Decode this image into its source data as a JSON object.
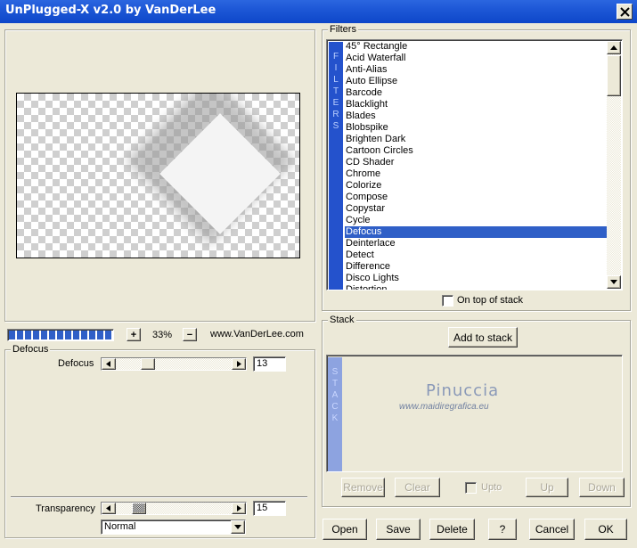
{
  "window": {
    "title": "UnPlugged-X v2.0 by VanDerLee"
  },
  "preview": {
    "zoom": "33%",
    "website": "www.VanDerLee.com",
    "zoom_plus": "+",
    "zoom_minus": "−"
  },
  "defocus": {
    "group_label": "Defocus",
    "param_label": "Defocus",
    "param_value": "13",
    "transparency_label": "Transparency",
    "transparency_value": "15",
    "blend_mode": "Normal"
  },
  "filters": {
    "group_label": "Filters",
    "sidebar_letters": [
      "F",
      "I",
      "L",
      "T",
      "E",
      "R",
      "S"
    ],
    "items": [
      "45° Rectangle",
      "Acid Waterfall",
      "Anti-Alias",
      "Auto Ellipse",
      "Barcode",
      "Blacklight",
      "Blades",
      "Blobspike",
      "Brighten Dark",
      "Cartoon Circles",
      "CD Shader",
      "Chrome",
      "Colorize",
      "Compose",
      "Copystar",
      "Cycle",
      "Defocus",
      "Deinterlace",
      "Detect",
      "Difference",
      "Disco Lights",
      "Distortion"
    ],
    "selected": "Defocus",
    "on_top_label": "On top of stack"
  },
  "stack": {
    "group_label": "Stack",
    "add_label": "Add to stack",
    "sidebar_letters": [
      "S",
      "T",
      "A",
      "C",
      "K"
    ],
    "watermark_name": "Pinuccia",
    "watermark_url": "www.maidiregrafica.eu",
    "remove_label": "Remove",
    "clear_label": "Clear",
    "upto_label": "Upto",
    "up_label": "Up",
    "down_label": "Down"
  },
  "buttons": {
    "open": "Open",
    "save": "Save",
    "delete": "Delete",
    "help": "?",
    "cancel": "Cancel",
    "ok": "OK"
  }
}
